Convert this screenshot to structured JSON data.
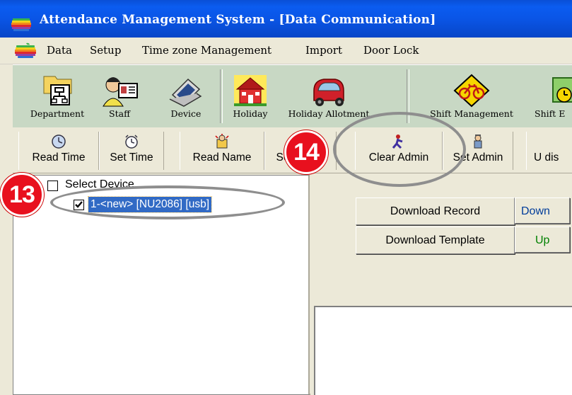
{
  "window": {
    "title": "Attendance Management System - [Data Communication]",
    "app_icon": "apple-logo-icon"
  },
  "menu": [
    "Data",
    "Setup",
    "Time zone Management",
    "Import",
    "Door Lock"
  ],
  "toolbar_main": [
    {
      "label": "Department",
      "icon": "department-icon"
    },
    {
      "label": "Staff",
      "icon": "staff-icon"
    },
    {
      "label": "Device",
      "icon": "device-icon"
    },
    {
      "label": "Holiday",
      "icon": "holiday-icon"
    },
    {
      "label": "Holiday Allotment",
      "icon": "holiday-allotment-icon"
    },
    {
      "label": "Shift Management",
      "icon": "shift-management-icon"
    },
    {
      "label": "Shift E",
      "icon": "shift-icon"
    }
  ],
  "toolbar_device": [
    {
      "label": "Read Time",
      "icon": "clock-read-icon"
    },
    {
      "label": "Set Time",
      "icon": "clock-set-icon"
    },
    {
      "label": "Read Name",
      "icon": "read-name-icon"
    },
    {
      "label": "Set Name",
      "icon": "set-name-icon"
    },
    {
      "label": "Clear Admin",
      "icon": "clear-admin-icon"
    },
    {
      "label": "Set Admin",
      "icon": "set-admin-icon"
    },
    {
      "label": "U dis",
      "icon": ""
    }
  ],
  "device_tree": {
    "root_label": "Select Device",
    "root_checked": false,
    "devices": [
      {
        "label": "1-<new>   [NU2086]   [usb]",
        "checked": true,
        "selected": true
      }
    ]
  },
  "actions": {
    "download_record": "Download Record",
    "download_template": "Download Template",
    "col2_row1": "Down",
    "col2_row2": "Up"
  },
  "annotations": [
    {
      "number": "13"
    },
    {
      "number": "14"
    }
  ],
  "colors": {
    "title_bar": "#0a55e6",
    "toolbar_bg": "#c8d8c4",
    "selection": "#316ac5",
    "badge": "#e8101e",
    "upload_text": "#008000"
  }
}
